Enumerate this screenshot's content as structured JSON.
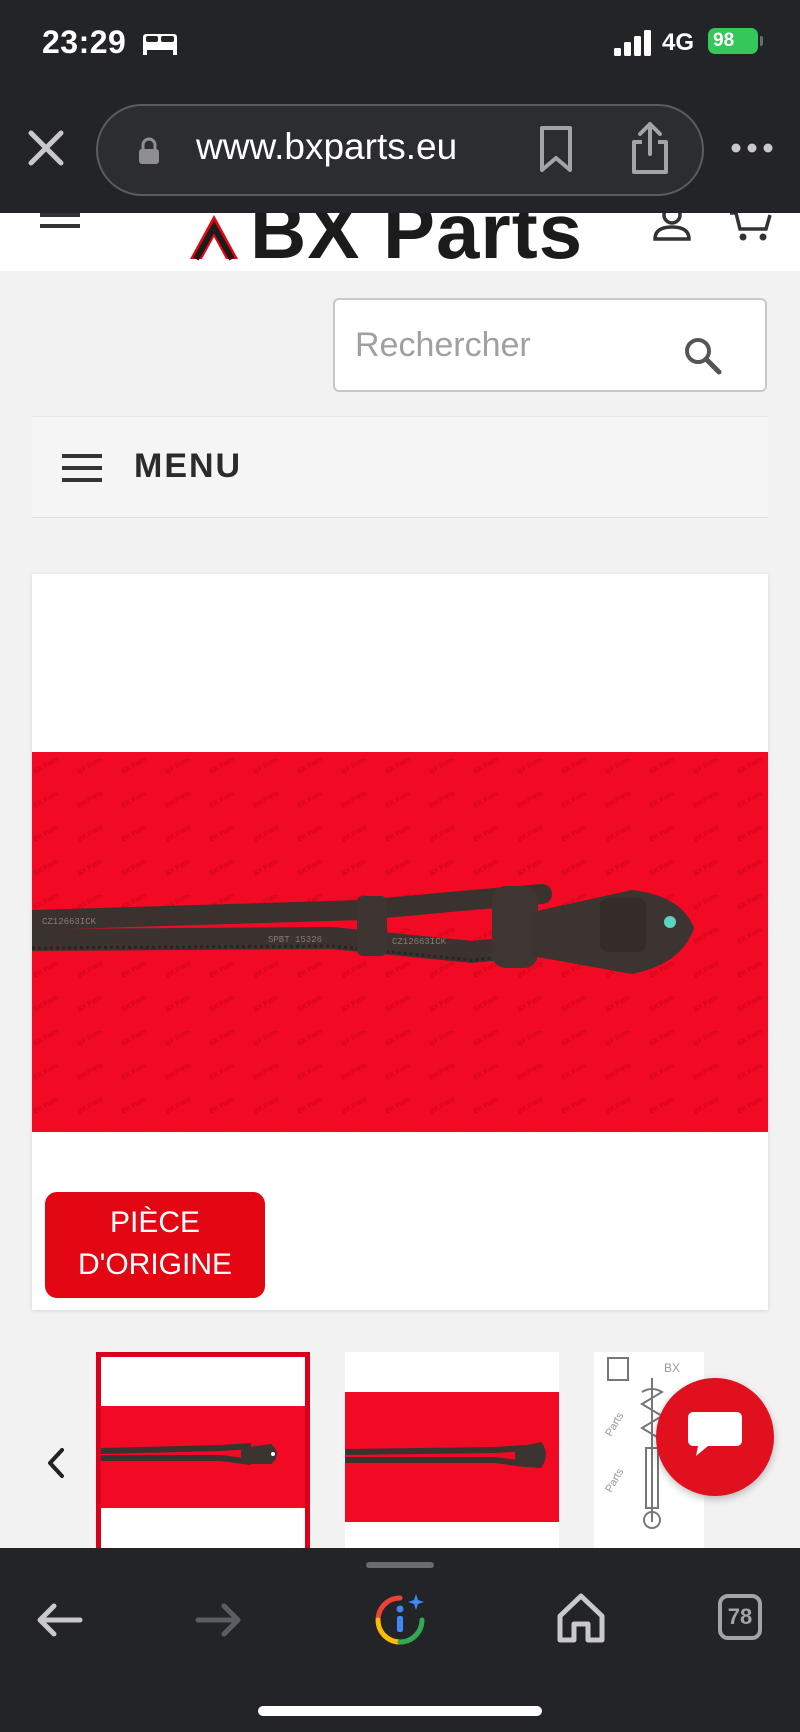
{
  "status_bar": {
    "time": "23:29",
    "network": "4G",
    "battery": "98"
  },
  "browser": {
    "url": "www.bxparts.eu",
    "open_tabs_count": "78"
  },
  "site": {
    "logo_text": "BX Parts",
    "search": {
      "placeholder": "Rechercher"
    },
    "menu_label": "MENU"
  },
  "product": {
    "badge_line1": "PIÈCE",
    "badge_line2": "D'ORIGINE",
    "photo_background": "#f20a24"
  },
  "colors": {
    "brand_red": "#e30613",
    "chrome_dark": "#232428",
    "battery_green": "#34c759"
  },
  "icons": [
    "close-icon",
    "lock-icon",
    "bookmark-icon",
    "share-icon",
    "more-icon",
    "hamburger-icon",
    "user-icon",
    "cart-icon",
    "search-icon",
    "chevron-left-icon",
    "chat-icon",
    "back-arrow-icon",
    "forward-arrow-icon",
    "assistant-icon",
    "home-icon"
  ]
}
